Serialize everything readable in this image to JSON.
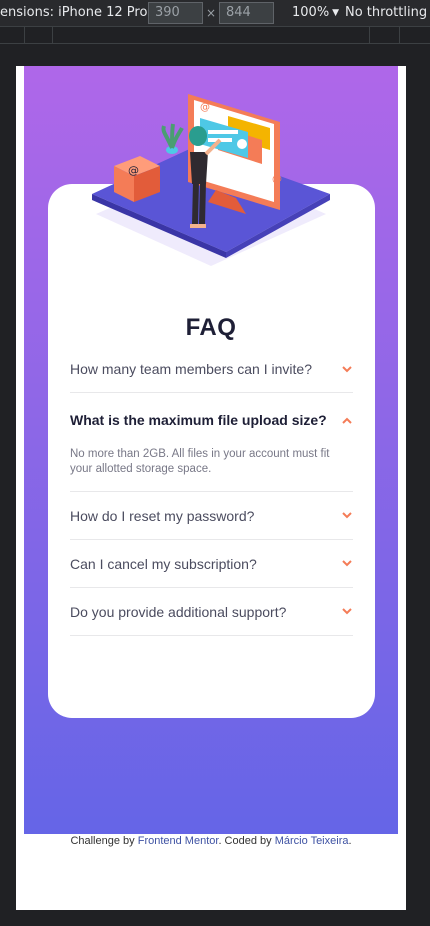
{
  "devtools": {
    "device_label": "ensions: iPhone 12 Pro",
    "width_value": "390",
    "height_value": "844",
    "times": "×",
    "zoom": "100%",
    "throttling": "No throttling"
  },
  "faq": {
    "title": "FAQ",
    "items": [
      {
        "question": "How many team members can I invite?",
        "answer": "",
        "open": false
      },
      {
        "question": "What is the maximum file upload size?",
        "answer": "No more than 2GB. All files in your account must fit your allotted storage space.",
        "open": true
      },
      {
        "question": "How do I reset my password?",
        "answer": "",
        "open": false
      },
      {
        "question": "Can I cancel my subscription?",
        "answer": "",
        "open": false
      },
      {
        "question": "Do you provide additional support?",
        "answer": "",
        "open": false
      }
    ]
  },
  "attribution": {
    "prefix": "Challenge by ",
    "challenge_link": "Frontend Mentor",
    "middle": ". Coded by ",
    "author_link": "Márcio Teixeira",
    "suffix": "."
  },
  "colors": {
    "gradient_top": "#af67e9",
    "gradient_bottom": "#6565e7",
    "chevron": "#f47c57",
    "title": "#1e1f36",
    "link": "#3e52a3"
  }
}
